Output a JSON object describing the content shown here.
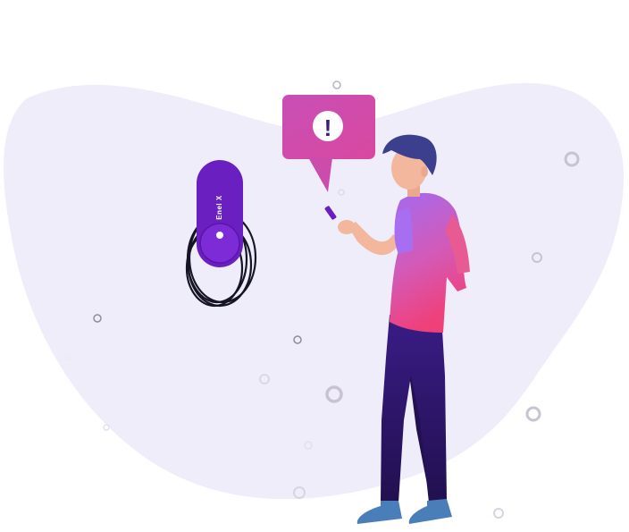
{
  "charger": {
    "brand_label": "Enel X",
    "icon": "ev-charger-icon"
  },
  "alert": {
    "symbol": "!",
    "icon": "exclamation-icon"
  },
  "person": {
    "icon": "person-with-phone-icon"
  },
  "colors": {
    "blob": "#efedf9",
    "charger": "#6a1fc0",
    "charger_disc": "#7c2bd6",
    "bubble": "#d14bb0",
    "shirt_top": "#a36af0",
    "shirt_bottom": "#f0407a",
    "pants": "#2a1566",
    "hair": "#3b3f8e",
    "shoes": "#4a7eb8",
    "skin": "#f2b79c"
  }
}
